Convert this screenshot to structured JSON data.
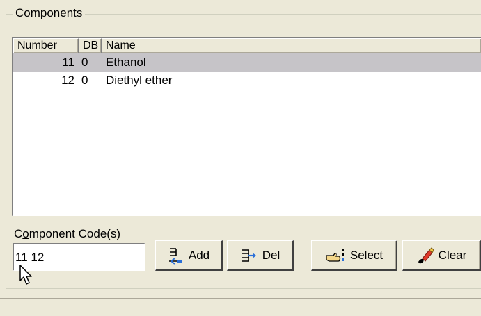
{
  "group": {
    "title": "Components"
  },
  "list": {
    "columns": [
      "Number",
      "DB",
      "Name"
    ],
    "rows": [
      {
        "number": "11",
        "db": "0",
        "name": "Ethanol",
        "selected": true
      },
      {
        "number": "12",
        "db": "0",
        "name": "Diethyl ether",
        "selected": false
      }
    ]
  },
  "code": {
    "label_pre": "C",
    "label_accel": "o",
    "label_post": "mponent Code(s)",
    "value": "11 12"
  },
  "buttons": {
    "add": {
      "pre": "",
      "accel": "A",
      "post": "dd",
      "icon": "add-icon"
    },
    "del": {
      "pre": "",
      "accel": "D",
      "post": "el",
      "icon": "delete-icon"
    },
    "select": {
      "pre": "Se",
      "accel": "l",
      "post": "ect",
      "icon": "select-hand-icon"
    },
    "clear": {
      "pre": "Clea",
      "accel": "r",
      "post": "",
      "icon": "eraser-icon"
    }
  },
  "colors": {
    "window_bg": "#ece9d8",
    "selected_row": "#c6c4c8",
    "accent_blue": "#2a6fd8",
    "eraser_red": "#e03a2a"
  }
}
